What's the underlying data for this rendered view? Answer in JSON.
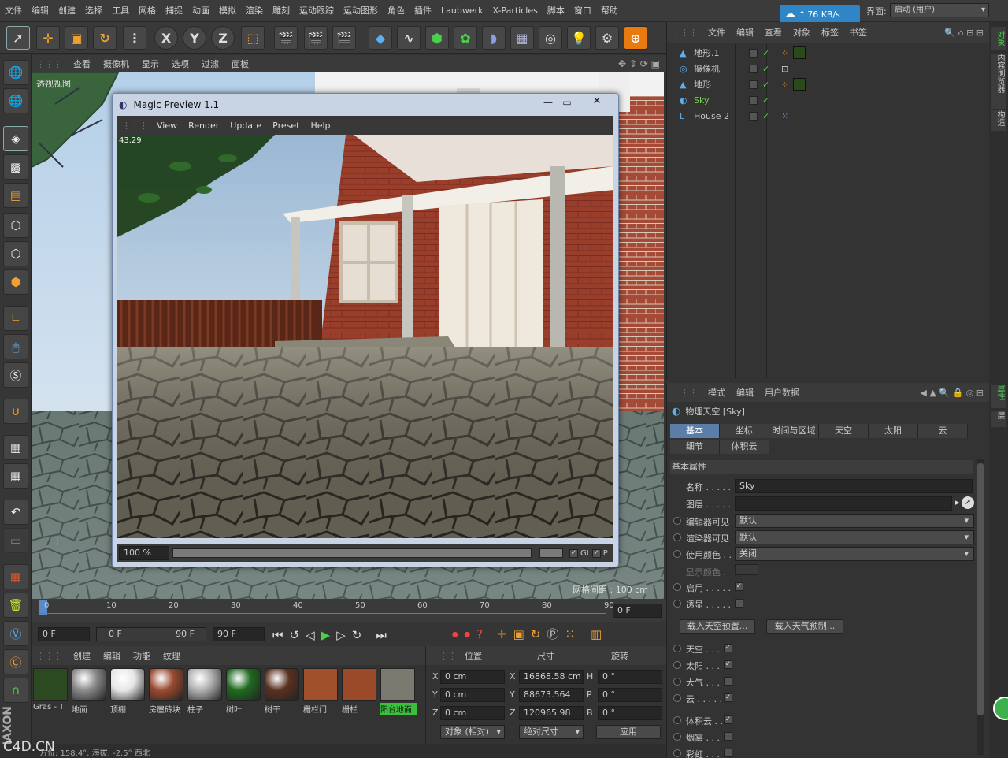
{
  "menubar": {
    "items": [
      "文件",
      "编辑",
      "创建",
      "选择",
      "工具",
      "网格",
      "捕捉",
      "动画",
      "模拟",
      "渲染",
      "雕刻",
      "运动跟踪",
      "运动图形",
      "角色",
      "插件",
      "Laubwerk",
      "X-Particles",
      "脚本",
      "窗口",
      "帮助"
    ],
    "net_speed": "76 KB/s",
    "interface_label": "界面:",
    "interface_value": "启动 (用户)"
  },
  "toolbar": {
    "axis_x": "X",
    "axis_y": "Y",
    "axis_z": "Z"
  },
  "viewport": {
    "menu": [
      "查看",
      "摄像机",
      "显示",
      "选项",
      "过滤",
      "面板"
    ],
    "label": "透视视图",
    "grid_spacing": "网格间距 : 100 cm"
  },
  "magic_preview": {
    "title": "Magic Preview 1.1",
    "menu": [
      "View",
      "Render",
      "Update",
      "Preset",
      "Help"
    ],
    "render_time": "43.29",
    "zoom": "100 %",
    "gi_label": "GI",
    "p_label": "P"
  },
  "timeline": {
    "ticks": [
      "0",
      "10",
      "20",
      "30",
      "40",
      "50",
      "60",
      "70",
      "80",
      "90"
    ],
    "current_frame": "0 F"
  },
  "transport": {
    "start": "0 F",
    "range_start": "0 F",
    "range_end": "90 F",
    "end": "90 F"
  },
  "materials": {
    "menu": [
      "创建",
      "编辑",
      "功能",
      "纹理"
    ],
    "items": [
      {
        "label": "Gras - T",
        "color": "#2c4a22"
      },
      {
        "label": "地面",
        "color": "#8a8a8a"
      },
      {
        "label": "顶棚",
        "color": "#e6e6e6"
      },
      {
        "label": "房屋砖块",
        "color": "#9a4a30"
      },
      {
        "label": "柱子",
        "color": "#b0b0b0"
      },
      {
        "label": "树叶",
        "color": "#1f6a1f"
      },
      {
        "label": "树干",
        "color": "#5a3020"
      },
      {
        "label": "栅栏门",
        "color": "#a0502a"
      },
      {
        "label": "栅栏",
        "color": "#9a4a28"
      },
      {
        "label": "阳台地面",
        "color": "#7a7a70"
      }
    ]
  },
  "coords": {
    "headers": [
      "位置",
      "尺寸",
      "旋转"
    ],
    "rows": [
      {
        "axis": "X",
        "pos": "0 cm",
        "size_axis": "X",
        "size": "16868.58 cm",
        "rot_axis": "H",
        "rot": "0 °"
      },
      {
        "axis": "Y",
        "pos": "0 cm",
        "size_axis": "Y",
        "size": "88673.564 cm",
        "rot_axis": "P",
        "rot": "0 °"
      },
      {
        "axis": "Z",
        "pos": "0 cm",
        "size_axis": "Z",
        "size": "120965.98 cm",
        "rot_axis": "B",
        "rot": "0 °"
      }
    ],
    "mode_select": "对象 (相对)",
    "size_select": "绝对尺寸",
    "apply": "应用"
  },
  "object_manager": {
    "menu": [
      "文件",
      "编辑",
      "查看",
      "对象",
      "标签",
      "书签"
    ],
    "objects": [
      {
        "name": "地形.1",
        "color": "#c8c8c8"
      },
      {
        "name": "摄像机",
        "color": "#c8c8c8"
      },
      {
        "name": "地形",
        "color": "#c8c8c8"
      },
      {
        "name": "Sky",
        "color": "#7cd34c"
      },
      {
        "name": "House 2",
        "color": "#c8c8c8"
      }
    ]
  },
  "attributes": {
    "menu": [
      "模式",
      "编辑",
      "用户数据"
    ],
    "object_title": "物理天空 [Sky]",
    "tabs_row1": [
      "基本",
      "坐标",
      "时间与区域",
      "天空",
      "太阳",
      "云"
    ],
    "tabs_row2": [
      "细节",
      "体积云"
    ],
    "section": "基本属性",
    "name_label": "名称 . . . . .",
    "name_value": "Sky",
    "layer_label": "图层 . . . . .",
    "editor_vis_label": "编辑器可见",
    "editor_vis_value": "默认",
    "render_vis_label": "渲染器可见",
    "render_vis_value": "默认",
    "use_color_label": "使用颜色 . .",
    "use_color_value": "关闭",
    "display_color_label": "显示颜色 .",
    "enable_label": "启用 . . . . .",
    "xray_label": "透显 . . . . .",
    "load_preset_btn": "载入天空预置...",
    "load_weather_btn": "载入天气预制...",
    "toggles": [
      {
        "label": "天空 . . .",
        "checked": true
      },
      {
        "label": "太阳 . . .",
        "checked": true
      },
      {
        "label": "大气 . . .",
        "checked": false
      },
      {
        "label": "云 . . . . .",
        "checked": true
      },
      {
        "label": "体积云 . .",
        "checked": true
      },
      {
        "label": "烟雾 . . .",
        "checked": false
      },
      {
        "label": "彩虹 . . .",
        "checked": false
      }
    ]
  },
  "right_strip": [
    "对象",
    "内容浏览器",
    "构造",
    "属性",
    "层"
  ],
  "statusbar": {
    "text": "方位: 158.4°, 海拔: -2.5° 西北",
    "watermark": "C4D.CN"
  }
}
